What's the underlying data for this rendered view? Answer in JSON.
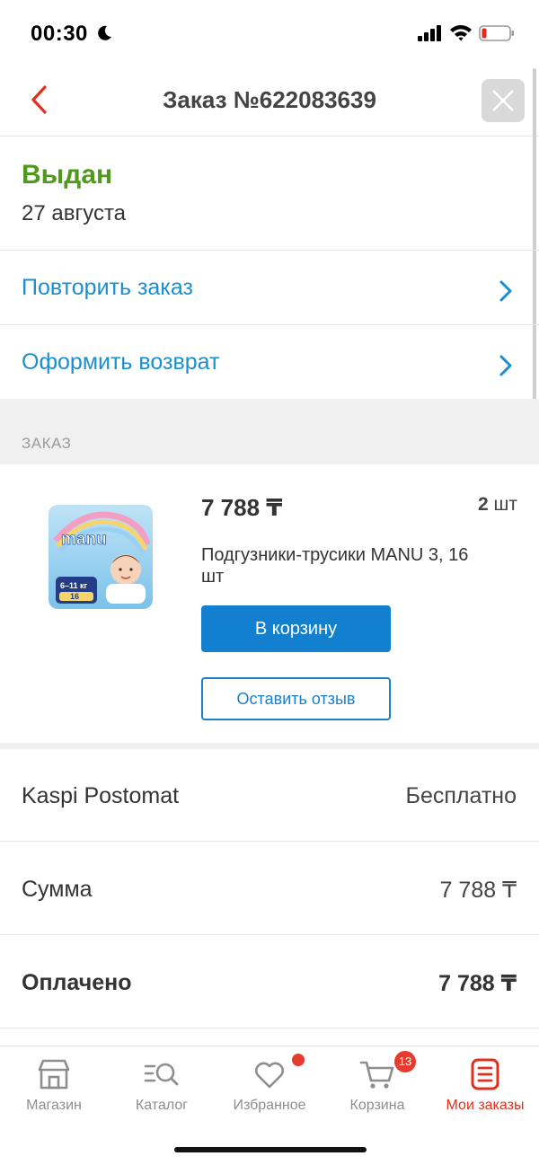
{
  "status_bar": {
    "time": "00:30",
    "icons": [
      "moon-icon",
      "signal-icon",
      "wifi-icon",
      "battery-icon"
    ]
  },
  "header": {
    "title": "Заказ №622083639",
    "back_icon": "chevron-left-icon",
    "close_icon": "close-icon"
  },
  "order": {
    "status": "Выдан",
    "date": "27 августа"
  },
  "actions": [
    {
      "label": "Повторить заказ"
    },
    {
      "label": "Оформить возврат"
    }
  ],
  "section": {
    "label": "ЗАКАЗ"
  },
  "product": {
    "price": "7 788 ₸",
    "quantity_number": "2",
    "quantity_unit": " шт",
    "name": "Подгузники-трусики MANU 3, 16 шт",
    "cart_button": "В корзину",
    "review_button": "Оставить отзыв",
    "image_text": {
      "brand": "manu",
      "weight": "6–11 кг",
      "count": "16"
    }
  },
  "summary": [
    {
      "label": "Kaspi Postomat",
      "value": "Бесплатно"
    },
    {
      "label": "Сумма",
      "value": "7 788 ₸"
    },
    {
      "label": "Оплачено",
      "value": "7 788 ₸"
    }
  ],
  "tab_bar": {
    "tabs": [
      {
        "label": "Магазин",
        "icon": "store-icon"
      },
      {
        "label": "Каталог",
        "icon": "catalog-search-icon"
      },
      {
        "label": "Избранное",
        "icon": "heart-icon"
      },
      {
        "label": "Корзина",
        "icon": "cart-icon"
      },
      {
        "label": "Мои заказы",
        "icon": "orders-icon"
      }
    ],
    "cart_badge": "13",
    "active_tab": "Мои заказы"
  },
  "colors": {
    "status_green": "#4f9a1c",
    "link_blue": "#1a8fd0",
    "button_blue": "#1380cf",
    "active_red": "#e0301e",
    "badge_red": "#e83a2f"
  }
}
